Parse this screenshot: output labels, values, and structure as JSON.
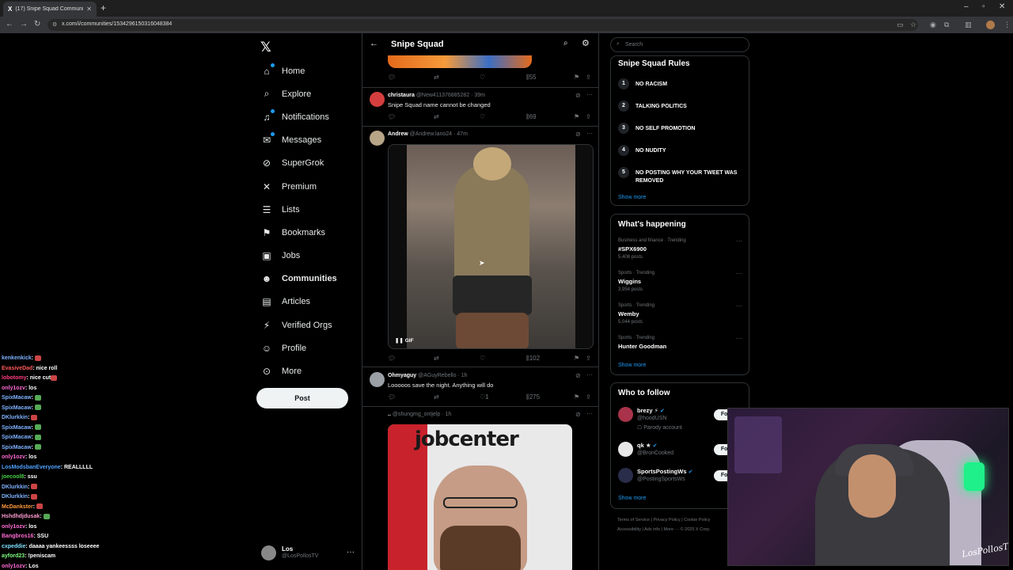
{
  "browser": {
    "tab_title": "(17) Snipe Squad Community /",
    "url": "x.com/i/communities/1534296150316048384"
  },
  "nav": {
    "items": [
      {
        "label": "Home",
        "icon": "home-icon"
      },
      {
        "label": "Explore",
        "icon": "search-icon"
      },
      {
        "label": "Notifications",
        "icon": "bell-icon"
      },
      {
        "label": "Messages",
        "icon": "mail-icon"
      },
      {
        "label": "SuperGrok",
        "icon": "grok-icon"
      },
      {
        "label": "Premium",
        "icon": "x-icon"
      },
      {
        "label": "Lists",
        "icon": "list-icon"
      },
      {
        "label": "Bookmarks",
        "icon": "bookmark-icon"
      },
      {
        "label": "Jobs",
        "icon": "briefcase-icon"
      },
      {
        "label": "Communities",
        "icon": "people-icon"
      },
      {
        "label": "Articles",
        "icon": "article-icon"
      },
      {
        "label": "Verified Orgs",
        "icon": "lightning-icon"
      },
      {
        "label": "Profile",
        "icon": "person-icon"
      },
      {
        "label": "More",
        "icon": "more-circle-icon"
      }
    ],
    "post_label": "Post",
    "account_name": "Los",
    "account_handle": "@LosPollosTV"
  },
  "chat": [
    {
      "user": "kenkenkick",
      "color": "#7fb2ff",
      "msg": "",
      "emote": "r"
    },
    {
      "user": "EvasiveDad",
      "color": "#ff5a5a",
      "msg": "nice roll",
      "emote": ""
    },
    {
      "user": "lobotomy",
      "color": "#ff3d7f",
      "msg": "nice cut",
      "emote": "r"
    },
    {
      "user": "only1ozv",
      "color": "#ff6bd3",
      "msg": "los",
      "emote": ""
    },
    {
      "user": "SpixMacaw",
      "color": "#7fb2ff",
      "msg": "",
      "emote": "g"
    },
    {
      "user": "SpixMacaw",
      "color": "#7fb2ff",
      "msg": "",
      "emote": "g"
    },
    {
      "user": "DKlurkkin",
      "color": "#7fb2ff",
      "msg": "",
      "emote": "r"
    },
    {
      "user": "SpixMacaw",
      "color": "#7fb2ff",
      "msg": "",
      "emote": "g"
    },
    {
      "user": "SpixMacaw",
      "color": "#7fb2ff",
      "msg": "",
      "emote": "g"
    },
    {
      "user": "SpixMacaw",
      "color": "#7fb2ff",
      "msg": "",
      "emote": "g"
    },
    {
      "user": "only1ozv",
      "color": "#ff6bd3",
      "msg": "los",
      "emote": ""
    },
    {
      "user": "LosModsbanEveryone",
      "color": "#4fa3ff",
      "msg": "REALLLLL",
      "emote": ""
    },
    {
      "user": "joecool8",
      "color": "#47d147",
      "msg": "ssu",
      "emote": ""
    },
    {
      "user": "DKlurkkin",
      "color": "#7fb2ff",
      "msg": "",
      "emote": "r"
    },
    {
      "user": "DKlurkkin",
      "color": "#7fb2ff",
      "msg": "",
      "emote": "r"
    },
    {
      "user": "McDankster",
      "color": "#ff9a3c",
      "msg": "",
      "emote": "r"
    },
    {
      "user": "Hshdhdjdusak",
      "color": "#ff9bd2",
      "msg": "",
      "emote": "g"
    },
    {
      "user": "only1ozv",
      "color": "#ff6bd3",
      "msg": "los",
      "emote": ""
    },
    {
      "user": "Bangbros16",
      "color": "#ff6bd3",
      "msg": "SSU",
      "emote": ""
    },
    {
      "user": "cxpeddie",
      "color": "#7fe0ff",
      "msg": "daaaa yankeessss loseeee",
      "emote": ""
    },
    {
      "user": "ayford23",
      "color": "#7fff7f",
      "msg": "!peniscam",
      "emote": ""
    },
    {
      "user": "only1ozv",
      "color": "#ff6bd3",
      "msg": "Los",
      "emote": ""
    }
  ],
  "community": {
    "title": "Snipe Squad",
    "tweets": [
      {
        "name": "",
        "handle": "",
        "time": "",
        "text": "",
        "views": "55"
      },
      {
        "name": "christaura",
        "handle": "@New411376885282",
        "time": "39m",
        "text": "Snipe Squad name cannot be changed",
        "views": "69",
        "likes": ""
      },
      {
        "name": "Andrew",
        "handle": "@Andrew.lano24",
        "time": "47m",
        "text": "",
        "views": "102",
        "media_label": "GIF"
      },
      {
        "name": "Ohmyaguy",
        "handle": "@AGuyRebello",
        "time": "1h",
        "text": "Looooos save the night. Anything will do",
        "views": "275",
        "likes": "1"
      },
      {
        "name": "..",
        "handle": "@shungmg_ontjelp",
        "time": "1h",
        "text": "",
        "image_text": "jobcenter"
      }
    ]
  },
  "right": {
    "search_placeholder": "Search",
    "rules_title": "Snipe Squad Rules",
    "rules": [
      {
        "num": "1",
        "text": "NO RACISM"
      },
      {
        "num": "2",
        "text": "TALKING POLITICS"
      },
      {
        "num": "3",
        "text": "NO SELF PROMOTION"
      },
      {
        "num": "4",
        "text": "NO NUDITY"
      },
      {
        "num": "5",
        "text": "NO POSTING WHY YOUR TWEET WAS REMOVED"
      }
    ],
    "show_more": "Show more",
    "happening_title": "What's happening",
    "trends": [
      {
        "meta": "Business and finance · Trending",
        "name": "#SPX6900",
        "posts": "5,408 posts"
      },
      {
        "meta": "Sports · Trending",
        "name": "Wiggins",
        "posts": "3,954 posts"
      },
      {
        "meta": "Sports · Trending",
        "name": "Wemby",
        "posts": "5,044 posts"
      },
      {
        "meta": "Sports · Trending",
        "name": "Hunter Goodman",
        "posts": ""
      }
    ],
    "wtf_title": "Who to follow",
    "follows": [
      {
        "name": "brezy ⚡",
        "handle": "@hoodUSN",
        "parody": "Parody account"
      },
      {
        "name": "qk ★",
        "handle": "@BronCooked",
        "parody": ""
      },
      {
        "name": "SportsPostingWs",
        "handle": "@PostingSportsWs",
        "parody": ""
      }
    ],
    "follow_label": "Follow",
    "footer1": "Terms of Service  |  Privacy Policy  |  Cookie Policy",
    "footer2": "Accessibility  |  Ads info  |  More ···  © 2025 X Corp."
  },
  "webcam": {
    "signature": "LosPollosTV"
  }
}
